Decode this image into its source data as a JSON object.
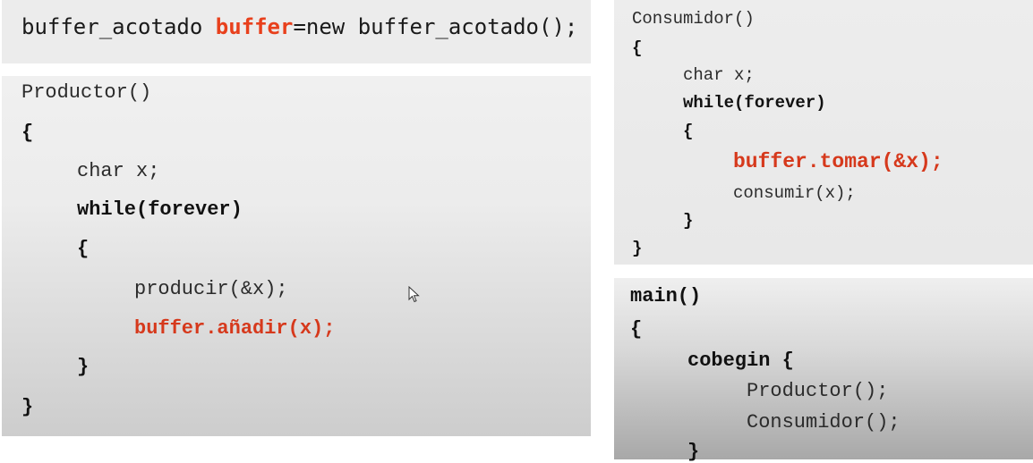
{
  "top": {
    "prefix": "buffer_acotado ",
    "keyword": "buffer",
    "suffix": "=new buffer_acotado();"
  },
  "productor": {
    "lines": [
      "Productor()",
      "{",
      "char x;",
      "while(forever)",
      "{",
      "producir(&x);",
      "buffer.añadir(x);",
      "}",
      "}"
    ]
  },
  "consumidor": {
    "lines": [
      "Consumidor()",
      "{",
      "char x;",
      "while(forever)",
      "{",
      "buffer.tomar(&x);",
      "consumir(x);",
      "}",
      "}"
    ]
  },
  "main": {
    "lines": [
      "main()",
      "{",
      "cobegin {",
      "Productor();",
      "Consumidor();",
      "}"
    ]
  },
  "colors": {
    "highlight": "#d6391c",
    "keyword": "#e8401c",
    "panel": "#ececec"
  },
  "icons": {
    "cursor": "mouse-pointer-icon"
  }
}
